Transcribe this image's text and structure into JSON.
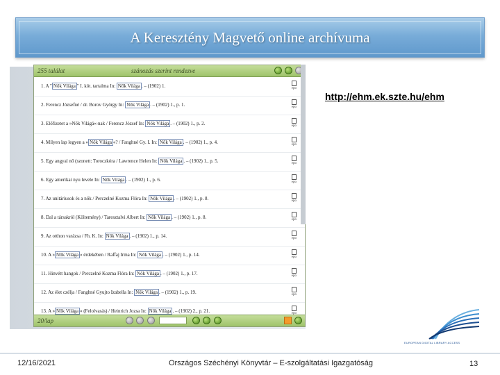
{
  "slide": {
    "title": "A Keresztény Magvető online archívuma",
    "url": "http://ehm.ek.szte.hu/ehm",
    "logo_text": "EUROPEAN DIGITAL LIBRARY ACCESS"
  },
  "screenshot": {
    "count_label": "255 találat",
    "sort_label": "szánozás szerint rendezve",
    "footer_page": "20/lap",
    "icon_label": "epo",
    "rows": [
      {
        "pre": "1.  A \"",
        "tag": "Nők Világa",
        "mid": "\" I. köt. tartalma In: ",
        "tag2": "Nők Világa",
        "post": ". – (1902) 1."
      },
      {
        "pre": "2.  Ferencz Józsefné / dr. Borov György In: ",
        "tag": "Nők Világa",
        "mid": ". – (1902) 1., p. 1.",
        "tag2": "",
        "post": ""
      },
      {
        "pre": "3.  Előfizetet a »Nők Világá«-nak / Ferencz József In: ",
        "tag": "Nők Világa",
        "mid": ". – (1902) 1., p. 2.",
        "tag2": "",
        "post": ""
      },
      {
        "pre": "4.  Milyen lap legyen a »",
        "tag": "Nők Világa",
        "mid": "«? / Fanghné Gy. I. In: ",
        "tag2": "Nők Világa",
        "post": ". – (1902) 1., p. 4."
      },
      {
        "pre": "5.  Egy angyal nő (szonett: Toroczkóra / Lawrence Helen In: ",
        "tag": "Nők Világa",
        "mid": ". – (1902) 1., p. 5.",
        "tag2": "",
        "post": ""
      },
      {
        "pre": "6.  Egy amerikai nyu levele In: ",
        "tag": "Nők Világa",
        "mid": ". – (1902) 1., p. 6.",
        "tag2": "",
        "post": ""
      },
      {
        "pre": "7.  Az unitáriusok és a nők / Perczelné Kozma Flóra In: ",
        "tag": "Nők Világa",
        "mid": ". – (1902) 1., p. 8.",
        "tag2": "",
        "post": ""
      },
      {
        "pre": "8.  Dal a társakról (Költemény) / Taresztalvi Albert In: ",
        "tag": "Nők Világa",
        "mid": ". – (1902) 1., p. 8.",
        "tag2": "",
        "post": ""
      },
      {
        "pre": "9.  Az otthon varázsa / Fh. K. In: ",
        "tag": "Nők Világa",
        "mid": ". – (1902) 1., p. 14.",
        "tag2": "",
        "post": ""
      },
      {
        "pre": "10.  A »",
        "tag": "Nők Világa",
        "mid": "« érdekében / Raffaj Irma In: ",
        "tag2": "Nők Világa",
        "post": ". – (1902) 1., p. 14."
      },
      {
        "pre": "11.  Hinvétt hangok / Perczelné Kozma Flóra In: ",
        "tag": "Nők Világa",
        "mid": ". – (1902) 1., p. 17.",
        "tag2": "",
        "post": ""
      },
      {
        "pre": "12.  Az élet czélja / Fanghné Gyujto Izabella In: ",
        "tag": "Nők Világa",
        "mid": ". – (1902) 1., p. 19.",
        "tag2": "",
        "post": ""
      },
      {
        "pre": "13.  A »",
        "tag": "Nők Világa",
        "mid": "« (Felolvasás) / Heinrich Jozsa In: ",
        "tag2": "Nők Világa",
        "post": ". – (1902) 2., p. 21."
      }
    ]
  },
  "footer": {
    "date": "12/16/2021",
    "center": "Országos Széchényi Könyvtár – E-szolgáltatási Igazgatóság",
    "page_number": "13"
  }
}
